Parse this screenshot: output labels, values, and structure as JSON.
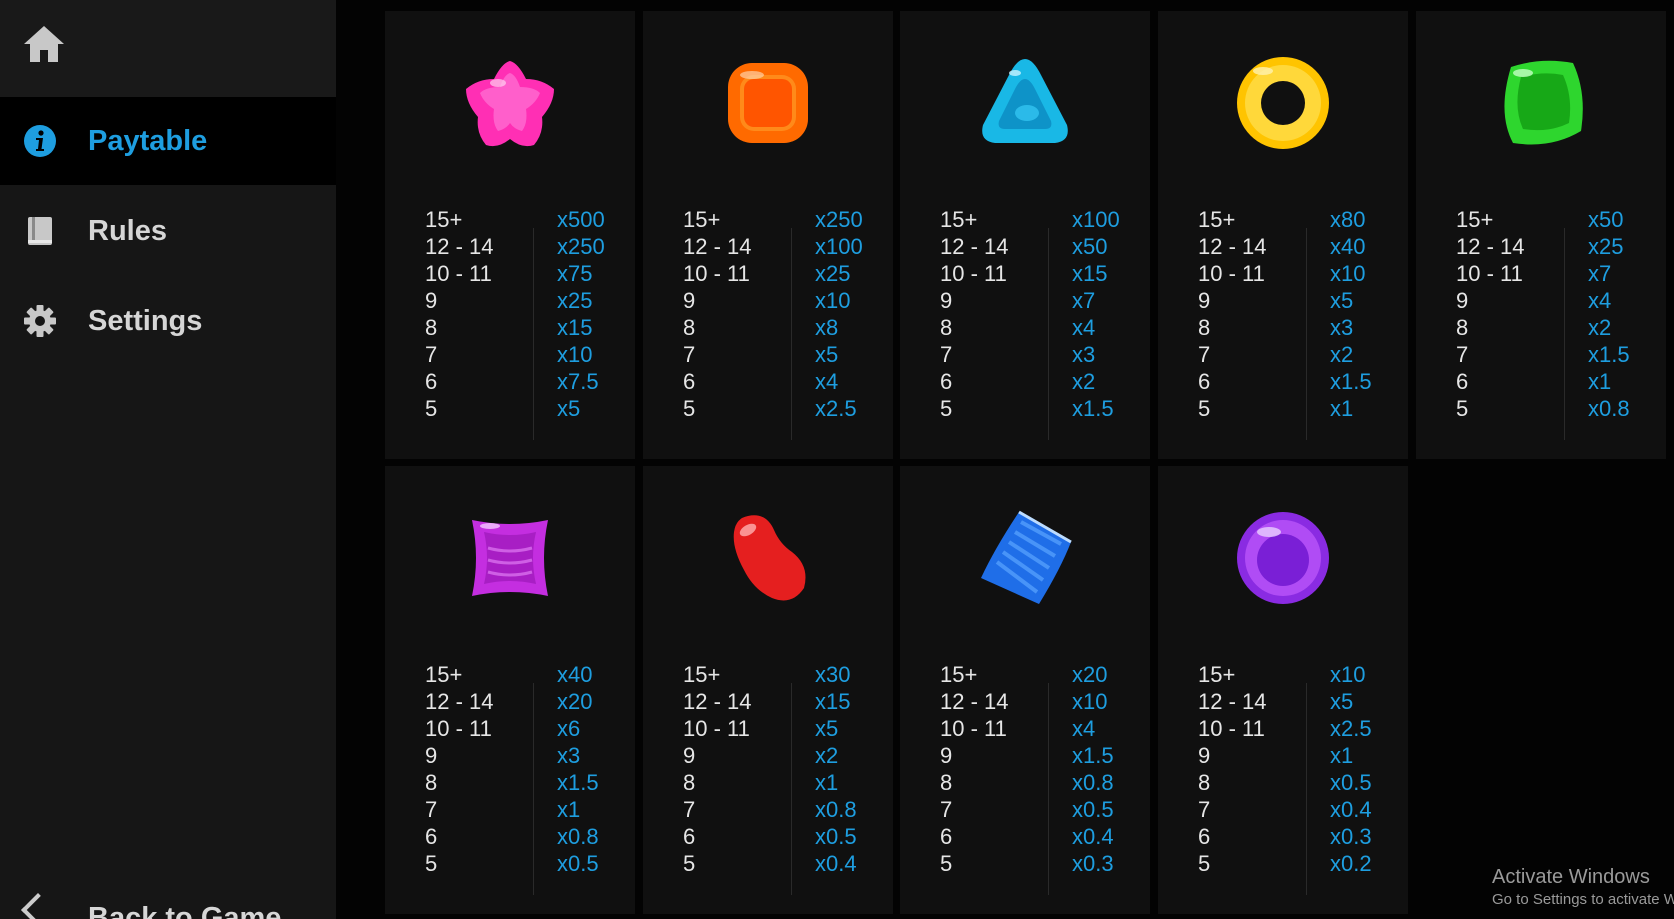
{
  "sidebar": {
    "home_icon": "home-icon",
    "items": [
      {
        "label": "Paytable",
        "icon": "info-icon",
        "active": true
      },
      {
        "label": "Rules",
        "icon": "book-icon",
        "active": false
      },
      {
        "label": "Settings",
        "icon": "gear-icon",
        "active": false
      }
    ],
    "back_label": "Back to Game"
  },
  "close_icon": "close-icon",
  "counts": [
    "15+",
    "12 - 14",
    "10 - 11",
    "9",
    "8",
    "7",
    "6",
    "5"
  ],
  "symbols": [
    {
      "icon": "pink-star-candy-icon",
      "color": "#ff2fb4",
      "payouts": [
        "x500",
        "x250",
        "x75",
        "x25",
        "x15",
        "x10",
        "x7.5",
        "x5"
      ]
    },
    {
      "icon": "orange-square-candy-icon",
      "color": "#ff6a00",
      "payouts": [
        "x250",
        "x100",
        "x25",
        "x10",
        "x8",
        "x5",
        "x4",
        "x2.5"
      ]
    },
    {
      "icon": "blue-triangle-candy-icon",
      "color": "#19b8e6",
      "payouts": [
        "x100",
        "x50",
        "x15",
        "x7",
        "x4",
        "x3",
        "x2",
        "x1.5"
      ]
    },
    {
      "icon": "yellow-ring-candy-icon",
      "color": "#ffc400",
      "payouts": [
        "x80",
        "x40",
        "x10",
        "x5",
        "x3",
        "x2",
        "x1.5",
        "x1"
      ]
    },
    {
      "icon": "green-gem-candy-icon",
      "color": "#2ed62e",
      "payouts": [
        "x50",
        "x25",
        "x7",
        "x4",
        "x2",
        "x1.5",
        "x1",
        "x0.8"
      ]
    },
    {
      "icon": "purple-pillow-candy-icon",
      "color": "#c42ee0",
      "payouts": [
        "x40",
        "x20",
        "x6",
        "x3",
        "x1.5",
        "x1",
        "x0.8",
        "x0.5"
      ]
    },
    {
      "icon": "red-jellybean-candy-icon",
      "color": "#e51f1f",
      "payouts": [
        "x30",
        "x15",
        "x5",
        "x2",
        "x1",
        "x0.8",
        "x0.5",
        "x0.4"
      ]
    },
    {
      "icon": "blue-striped-candy-icon",
      "color": "#1f6ee8",
      "payouts": [
        "x20",
        "x10",
        "x4",
        "x1.5",
        "x0.8",
        "x0.5",
        "x0.4",
        "x0.3"
      ]
    },
    {
      "icon": "violet-orb-candy-icon",
      "color": "#8a2be2",
      "payouts": [
        "x10",
        "x5",
        "x2.5",
        "x1",
        "x0.5",
        "x0.4",
        "x0.3",
        "x0.2"
      ]
    }
  ],
  "watermark": {
    "line1": "Activate Windows",
    "line2": "Go to Settings to activate Windows."
  },
  "accent": "#1e9ee0"
}
